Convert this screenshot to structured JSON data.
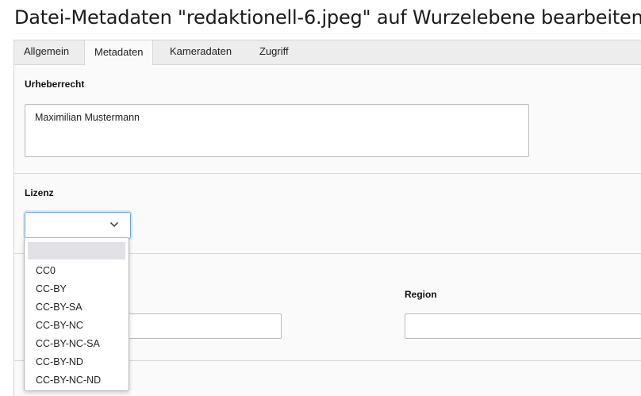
{
  "page": {
    "title": "Datei-Metadaten \"redaktionell-6.jpeg\" auf Wurzelebene bearbeiten"
  },
  "tabs": [
    {
      "label": "Allgemein",
      "active": false
    },
    {
      "label": "Metadaten",
      "active": true
    },
    {
      "label": "Kameradaten",
      "active": false
    },
    {
      "label": "Zugriff",
      "active": false
    }
  ],
  "fields": {
    "copyright": {
      "label": "Urheberrecht",
      "value": "Maximilian Mustermann"
    },
    "license": {
      "label": "Lizenz",
      "value": "",
      "options": [
        "",
        "CC0",
        "CC-BY",
        "CC-BY-SA",
        "CC-BY-NC",
        "CC-BY-NC-SA",
        "CC-BY-ND",
        "CC-BY-NC-ND"
      ]
    },
    "region": {
      "label": "Region",
      "value": ""
    }
  },
  "icons": {
    "select_chevron": "chevron-down-icon"
  },
  "colors": {
    "focus_border": "#6fa4d8",
    "tab_bar": "#ededed",
    "panel_bg": "#fafafa",
    "selected_option": "#e1e1e6"
  }
}
